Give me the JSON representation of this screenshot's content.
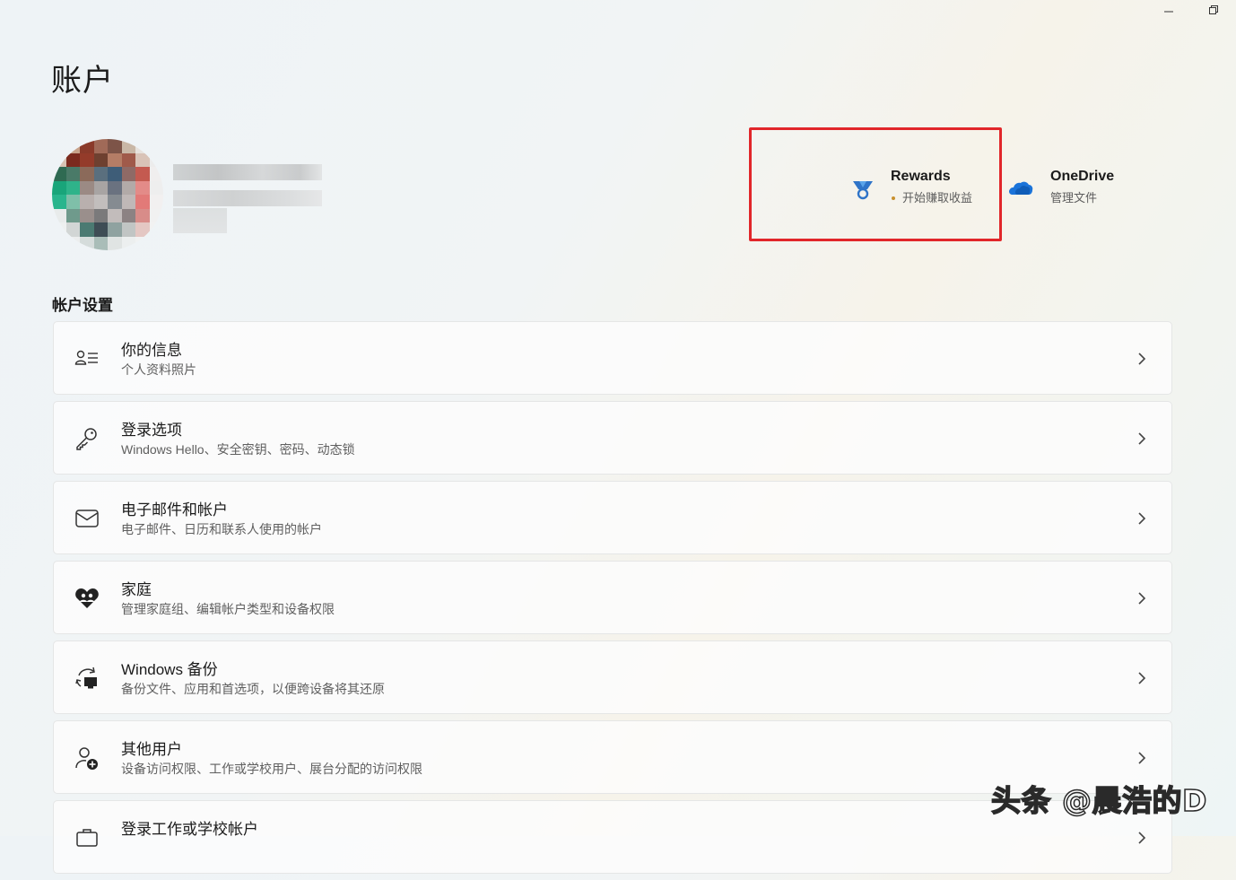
{
  "window": {
    "controls": [
      "minimize-icon",
      "restore-icon"
    ]
  },
  "page": {
    "title": "账户"
  },
  "user": {
    "avatar_icon": "user-avatar-pixelated"
  },
  "tiles": {
    "rewards": {
      "title": "Rewards",
      "subtitle": "开始赚取收益",
      "icon": "medal-icon",
      "dot_color": "#c8902d"
    },
    "onedrive": {
      "title": "OneDrive",
      "subtitle": "管理文件",
      "icon": "cloud-icon",
      "icon_color": "#1a73d9"
    }
  },
  "highlight_color": "#e1262a",
  "section": {
    "title": "帐户设置"
  },
  "settings": [
    {
      "title": "你的信息",
      "subtitle": "个人资料照片",
      "icon": "person-list-icon"
    },
    {
      "title": "登录选项",
      "subtitle": "Windows Hello、安全密钥、密码、动态锁",
      "icon": "key-icon"
    },
    {
      "title": "电子邮件和帐户",
      "subtitle": "电子邮件、日历和联系人使用的帐户",
      "icon": "mail-icon"
    },
    {
      "title": "家庭",
      "subtitle": "管理家庭组、编辑帐户类型和设备权限",
      "icon": "family-heart-icon"
    },
    {
      "title": "Windows 备份",
      "subtitle": "备份文件、应用和首选项，以便跨设备将其还原",
      "icon": "backup-sync-icon"
    },
    {
      "title": "其他用户",
      "subtitle": "设备访问权限、工作或学校用户、展台分配的访问权限",
      "icon": "add-person-icon"
    },
    {
      "title": "登录工作或学校帐户",
      "subtitle": "",
      "icon": "briefcase-icon"
    }
  ],
  "watermark": "头条 @晨浩的D"
}
